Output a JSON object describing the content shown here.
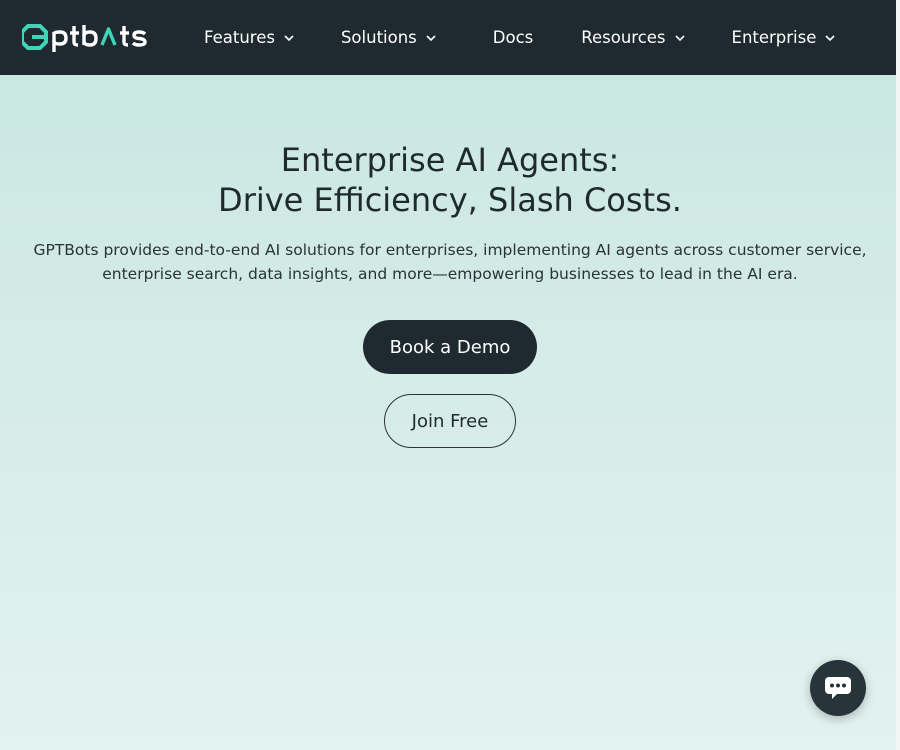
{
  "brand": {
    "name": "GPTBots"
  },
  "nav": {
    "items": [
      {
        "label": "Features",
        "has_dropdown": true
      },
      {
        "label": "Solutions",
        "has_dropdown": true
      },
      {
        "label": "Docs",
        "has_dropdown": false
      },
      {
        "label": "Resources",
        "has_dropdown": true
      },
      {
        "label": "Enterprise",
        "has_dropdown": true
      }
    ]
  },
  "hero": {
    "title_line1": "Enterprise AI Agents:",
    "title_line2": "Drive Efficiency, Slash Costs.",
    "subtitle_line1": "GPTBots provides end-to-end AI solutions for enterprises, implementing AI agents across customer service,",
    "subtitle_line2": "enterprise search, data insights, and more—empowering businesses to lead in the AI era.",
    "primary_cta": "Book a Demo",
    "secondary_cta": "Join Free"
  },
  "chat_widget": {
    "icon": "chat-bubble-icon"
  },
  "colors": {
    "navbar_bg": "#1f2a30",
    "logo_accent": "#3fd3b8",
    "hero_bg_top": "#c8e6e1",
    "hero_bg_bottom": "#e2f2ef",
    "text_dark": "#1f2a2e"
  }
}
